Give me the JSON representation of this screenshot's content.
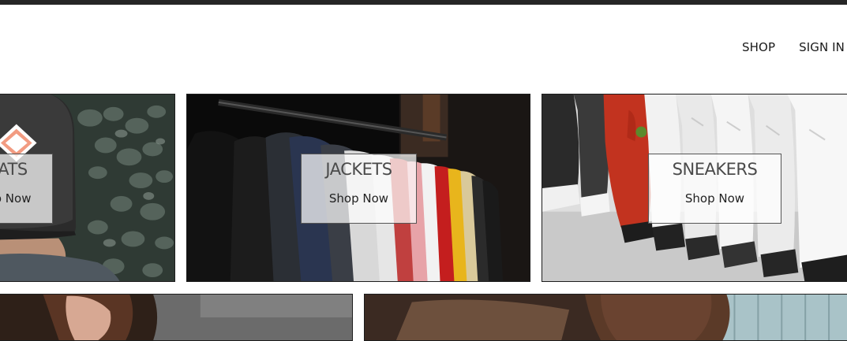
{
  "nav": {
    "shop_label": "SHOP",
    "sign_in_label": "SIGN IN"
  },
  "categories": [
    {
      "title": "ATS",
      "cta": "p Now"
    },
    {
      "title": "JACKETS",
      "cta": "Shop Now"
    },
    {
      "title": "SNEAKERS",
      "cta": "Shop Now"
    }
  ],
  "colors": {
    "top_bar": "#262626",
    "nav_text": "#1a1a1a",
    "label_overlay": "rgba(255,255,255,0.72)"
  }
}
